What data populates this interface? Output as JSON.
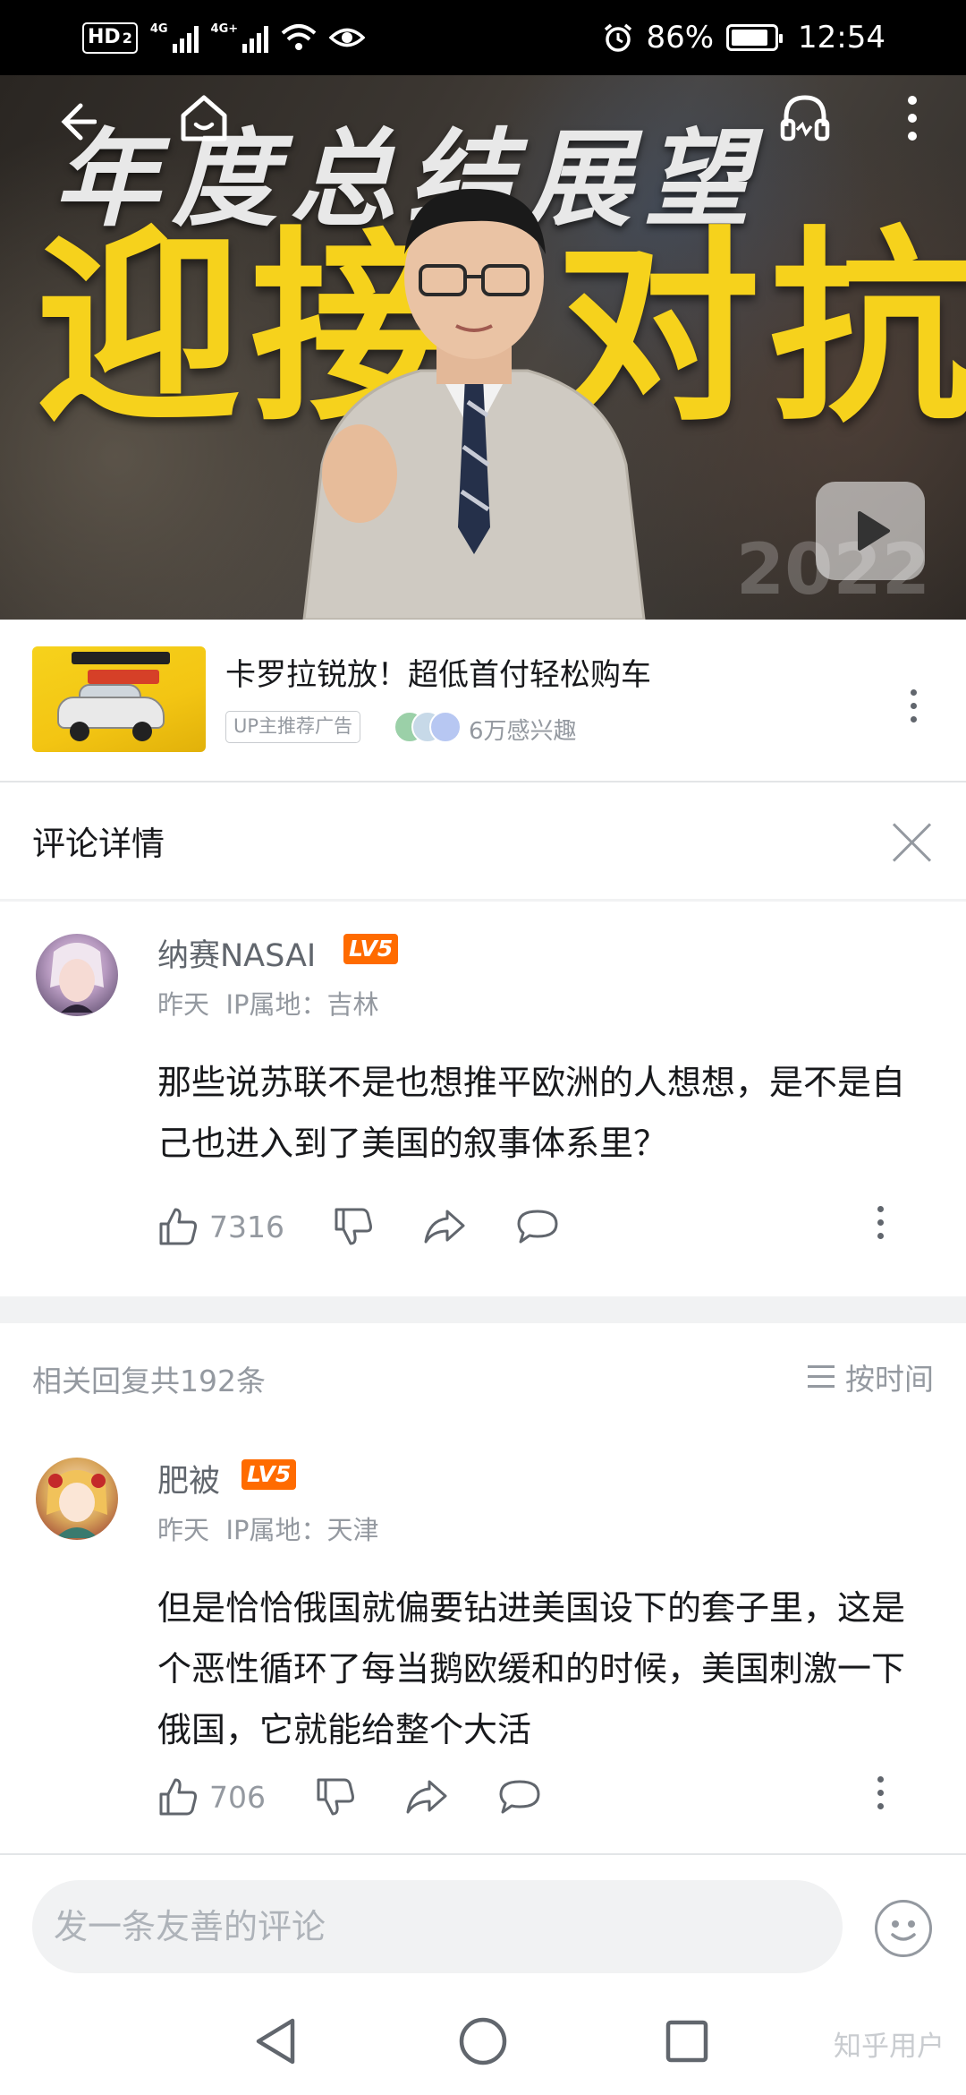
{
  "status_bar": {
    "hd_label": "HD",
    "hd_sub": "2",
    "sim1_label": "4G",
    "sim2_label": "4G+",
    "battery": "86%",
    "battery_level": 0.86,
    "time": "12:54"
  },
  "video": {
    "thumbnail_title": "年度总结展望",
    "thumbnail_headline_left": "迎接",
    "thumbnail_headline_right": "对抗",
    "thumbnail_year": "2022",
    "icons": [
      "back-arrow-icon",
      "home-icon",
      "headphones-icon",
      "more-icon",
      "play-icon"
    ]
  },
  "ad": {
    "title": "卡罗拉锐放！超低首付轻松购车",
    "tag": "UP主推荐广告",
    "interest": "6万感兴趣",
    "accent": "#f6d21c"
  },
  "detail": {
    "title": "评论详情"
  },
  "main_comment": {
    "username": "纳赛NASAI",
    "level": "LV5",
    "time": "昨天",
    "ip_location": "IP属地：吉林",
    "text": "那些说苏联不是也想推平欧洲的人想想，是不是自己也进入到了美国的叙事体系里？",
    "likes": "7316"
  },
  "related": {
    "count_label": "相关回复共192条",
    "sort_label": "按时间"
  },
  "reply": {
    "username": "肥被",
    "level": "LV5",
    "time": "昨天",
    "ip_location": "IP属地：天津",
    "text": "但是恰恰俄国就偏要钻进美国设下的套子里，这是个恶性循环了每当鹅欧缓和的时候，美国刺激一下俄国，它就能给整个大活",
    "likes": "706"
  },
  "input": {
    "placeholder": "发一条友善的评论"
  },
  "watermark": "知乎用户",
  "colors": {
    "level_badge": "#ff6b00",
    "secondary_text": "#9499a0",
    "primary_text": "#18191c"
  }
}
